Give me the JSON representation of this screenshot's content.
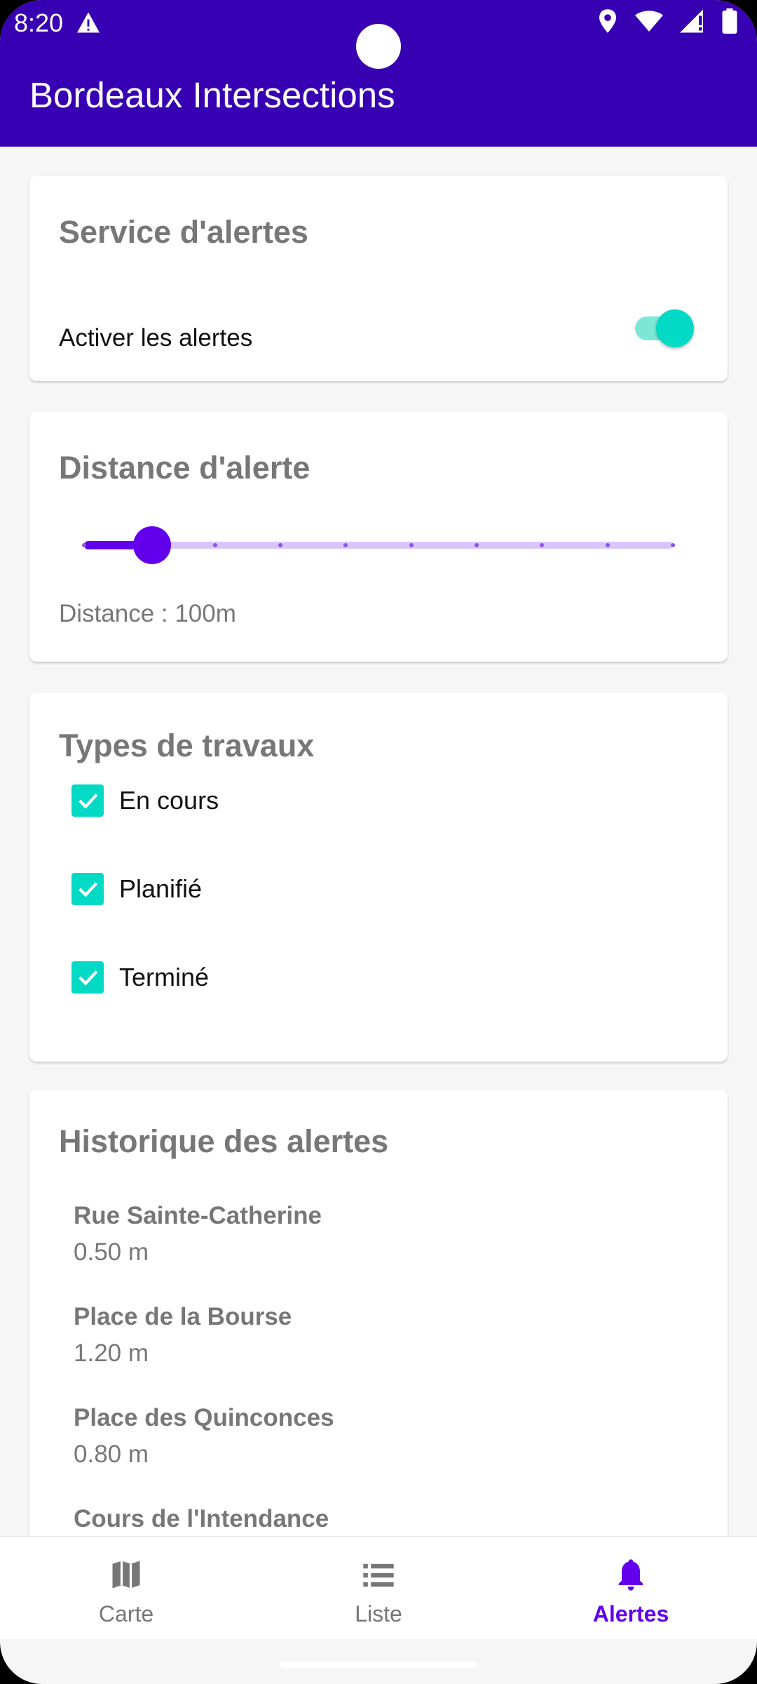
{
  "status_bar": {
    "time": "8:20"
  },
  "app_bar": {
    "title": "Bordeaux Intersections"
  },
  "alert_service": {
    "title": "Service d'alertes",
    "switch_label": "Activer les alertes",
    "enabled": true
  },
  "alert_distance": {
    "title": "Distance d'alerte",
    "label": "Distance : 100m",
    "slider_value": 100,
    "slider_steps": 9
  },
  "work_types": {
    "title": "Types de travaux",
    "items": [
      {
        "label": "En cours",
        "checked": true
      },
      {
        "label": "Planifié",
        "checked": true
      },
      {
        "label": "Terminé",
        "checked": true
      }
    ]
  },
  "history": {
    "title": "Historique des alertes",
    "items": [
      {
        "name": "Rue Sainte-Catherine",
        "distance": "0.50 m"
      },
      {
        "name": "Place de la Bourse",
        "distance": "1.20 m"
      },
      {
        "name": "Place des Quinconces",
        "distance": "0.80 m"
      },
      {
        "name": "Cours de l'Intendance",
        "distance": ""
      }
    ]
  },
  "bottom_nav": {
    "items": [
      {
        "label": "Carte",
        "icon": "map-icon",
        "active": false
      },
      {
        "label": "Liste",
        "icon": "list-icon",
        "active": false
      },
      {
        "label": "Alertes",
        "icon": "bell-icon",
        "active": true
      }
    ]
  },
  "colors": {
    "app_bar": "#3700b3",
    "primary": "#6200ee",
    "accent": "#03dac5"
  }
}
